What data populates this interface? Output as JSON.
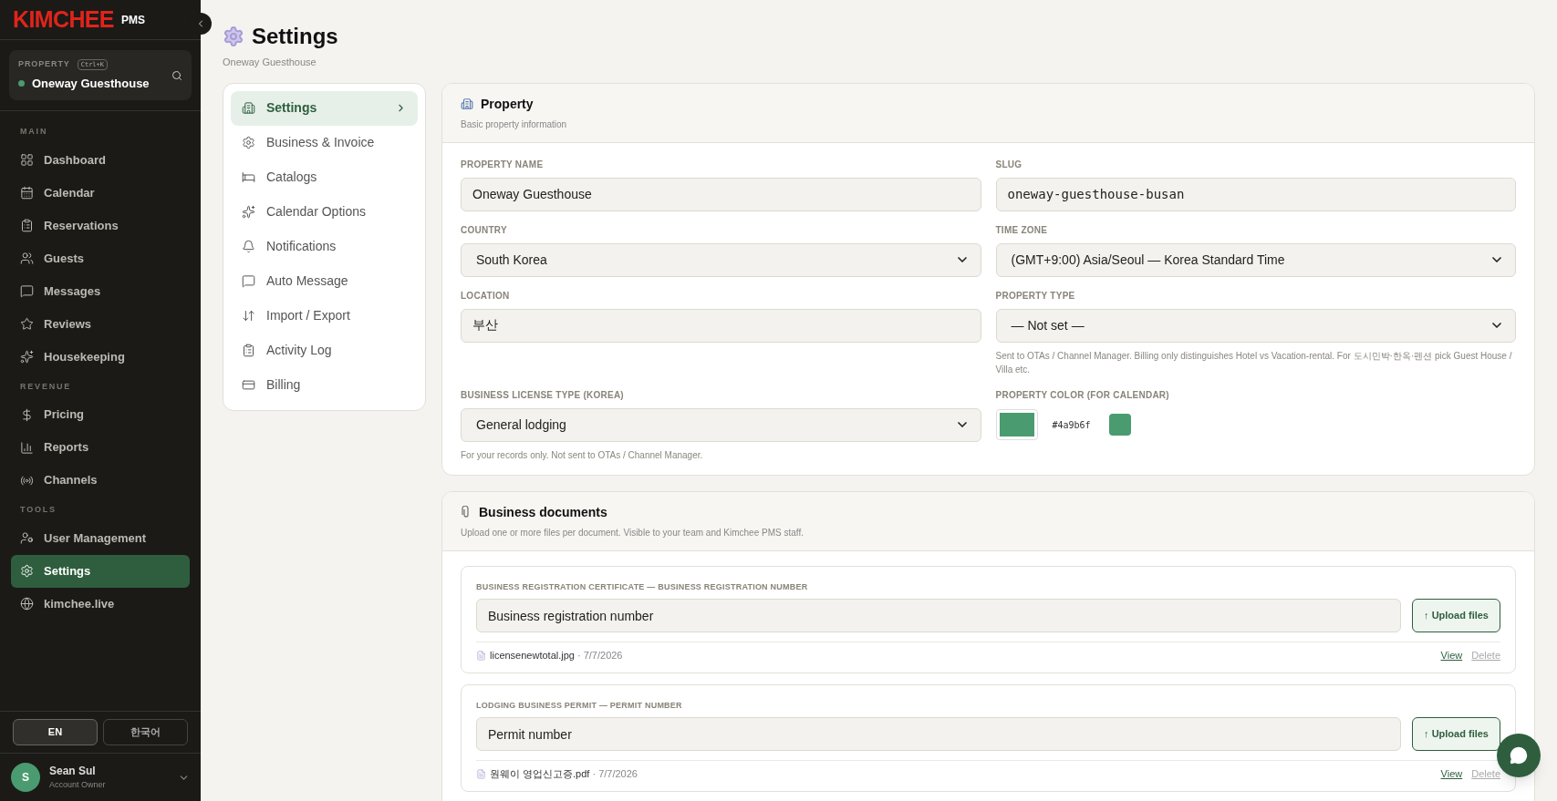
{
  "brand": {
    "name": "KIMCHEE",
    "suffix": "PMS"
  },
  "property_switcher": {
    "label": "PROPERTY",
    "shortcut": "Ctrl+K",
    "name": "Oneway Guesthouse",
    "color": "#4a9b6f"
  },
  "sidebar": {
    "sections": [
      {
        "title": "MAIN",
        "items": [
          {
            "label": "Dashboard",
            "selected": false
          },
          {
            "label": "Calendar",
            "selected": false
          },
          {
            "label": "Reservations",
            "selected": false
          },
          {
            "label": "Guests",
            "selected": false
          },
          {
            "label": "Messages",
            "selected": false
          },
          {
            "label": "Reviews",
            "selected": false
          },
          {
            "label": "Housekeeping",
            "selected": false
          }
        ]
      },
      {
        "title": "REVENUE",
        "items": [
          {
            "label": "Pricing",
            "selected": false
          },
          {
            "label": "Reports",
            "selected": false
          },
          {
            "label": "Channels",
            "selected": false
          }
        ]
      },
      {
        "title": "TOOLS",
        "items": [
          {
            "label": "User Management",
            "selected": false
          },
          {
            "label": "Settings",
            "selected": true
          },
          {
            "label": "kimchee.live",
            "selected": false
          }
        ]
      }
    ]
  },
  "languages": [
    {
      "label": "EN",
      "selected": true
    },
    {
      "label": "한국어",
      "selected": false
    }
  ],
  "user": {
    "initial": "S",
    "name": "Sean Sul",
    "role": "Account Owner"
  },
  "page": {
    "title": "Settings",
    "subtitle": "Oneway Guesthouse"
  },
  "settings_nav": [
    {
      "label": "Settings",
      "selected": true
    },
    {
      "label": "Business & Invoice",
      "selected": false
    },
    {
      "label": "Catalogs",
      "selected": false
    },
    {
      "label": "Calendar Options",
      "selected": false
    },
    {
      "label": "Notifications",
      "selected": false
    },
    {
      "label": "Auto Message",
      "selected": false
    },
    {
      "label": "Import / Export",
      "selected": false
    },
    {
      "label": "Activity Log",
      "selected": false
    },
    {
      "label": "Billing",
      "selected": false
    }
  ],
  "property_card": {
    "title": "Property",
    "subtitle": "Basic property information",
    "fields": [
      {
        "kind": "text",
        "label": "PROPERTY NAME",
        "value": "Oneway Guesthouse"
      },
      {
        "kind": "mono",
        "label": "SLUG",
        "value": "oneway-guesthouse-busan"
      },
      {
        "kind": "select",
        "label": "COUNTRY",
        "value": "South Korea"
      },
      {
        "kind": "select",
        "label": "TIME ZONE",
        "value": "(GMT+9:00) Asia/Seoul — Korea Standard Time"
      },
      {
        "kind": "text",
        "label": "LOCATION",
        "value": "부산"
      },
      {
        "kind": "select",
        "label": "PROPERTY TYPE",
        "value": "— Not set —",
        "hint": "Sent to OTAs / Channel Manager. Billing only distinguishes Hotel vs Vacation-rental. For 도시민박·한옥·펜션 pick Guest House / Villa etc."
      },
      {
        "kind": "select",
        "label": "BUSINESS LICENSE TYPE (KOREA)",
        "value": "General lodging",
        "hint": "For your records only. Not sent to OTAs / Channel Manager."
      },
      {
        "kind": "color",
        "label": "PROPERTY COLOR (FOR CALENDAR)",
        "value": "#4a9b6f",
        "color": "#4a9b6f"
      }
    ]
  },
  "documents_card": {
    "title": "Business documents",
    "subtitle": "Upload one or more files per document. Visible to your team and Kimchee PMS staff.",
    "documents": [
      {
        "label": "BUSINESS REGISTRATION CERTIFICATE — BUSINESS REGISTRATION NUMBER",
        "placeholder": "Business registration number",
        "upload": "↑ Upload files",
        "file": {
          "name": "licensenewtotal.jpg",
          "date": "· 7/7/2026",
          "view": "View",
          "delete": "Delete"
        }
      },
      {
        "label": "LODGING BUSINESS PERMIT — PERMIT NUMBER",
        "placeholder": "Permit number",
        "upload": "↑ Upload files",
        "file": {
          "name": "원웨이 영업신고증.pdf",
          "date": "· 7/7/2026",
          "view": "View",
          "delete": "Delete"
        }
      }
    ]
  }
}
